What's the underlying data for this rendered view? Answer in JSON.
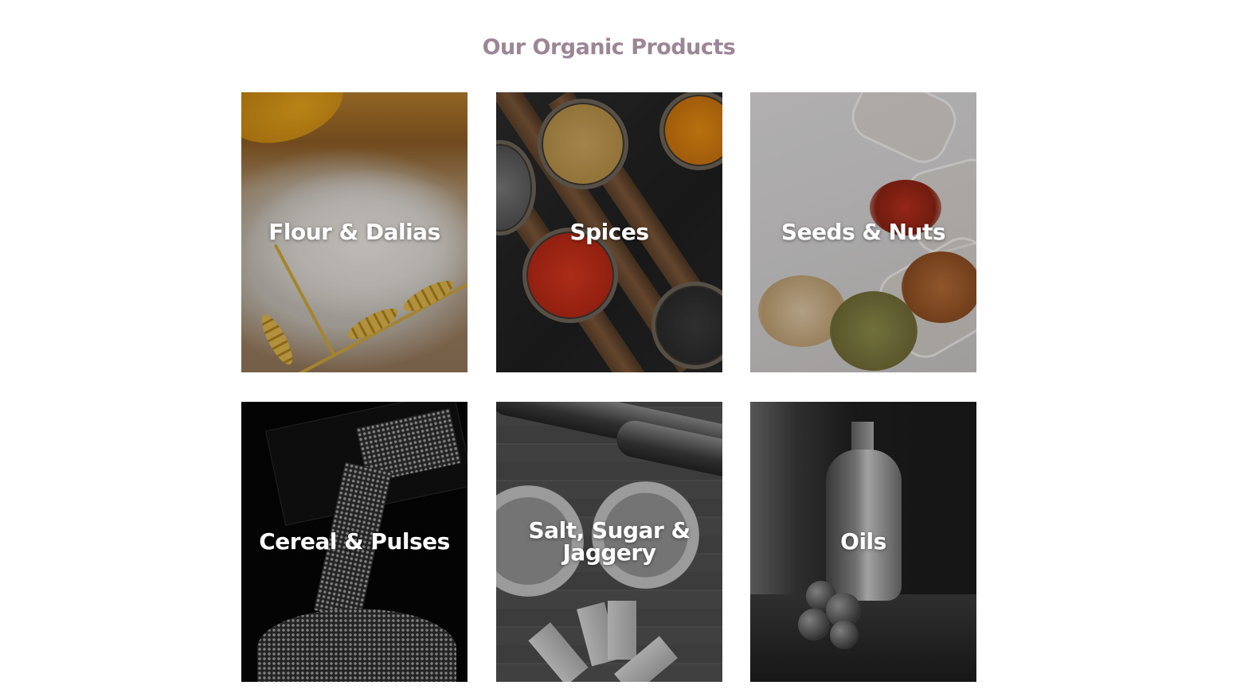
{
  "section": {
    "title": "Our Organic Products"
  },
  "products": [
    {
      "label": "Flour & Dalias"
    },
    {
      "label": "Spices"
    },
    {
      "label": "Seeds & Nuts"
    },
    {
      "label": "Cereal & Pulses"
    },
    {
      "label": "Salt, Sugar & Jaggery"
    },
    {
      "label": "Oils"
    }
  ],
  "colors": {
    "title": "#9c8696",
    "label": "#ffffff",
    "background": "#ffffff"
  }
}
